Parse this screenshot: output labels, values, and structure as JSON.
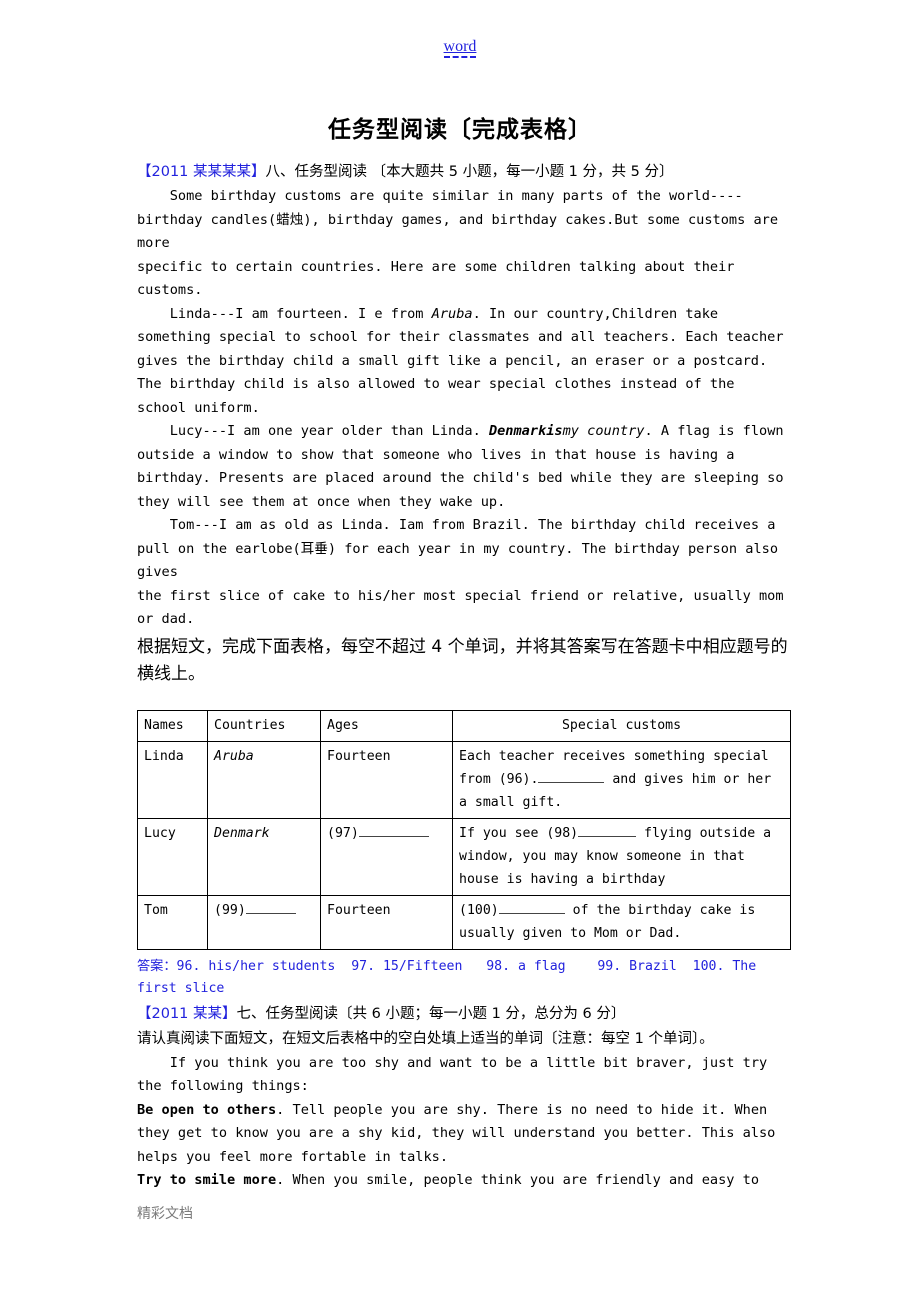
{
  "header": {
    "watermark_link": "word"
  },
  "title": "任务型阅读〔完成表格〕",
  "section1": {
    "heading_blue": "【2011 某某某某】",
    "heading_rest": "八、任务型阅读  〔本大题共 5 小题，每一小题 1 分，共 5 分〕",
    "p1_line1": "    Some birthday customs are quite similar in many parts of the world----",
    "p1_line2": "birthday candles(蜡烛), birthday games, and birthday cakes.But some customs are more",
    "p1_line3": "specific to certain countries. Here are some children talking about their",
    "p1_line4": "customs.",
    "p2_pre": "    Linda---I am fourteen. I e from ",
    "p2_italic": "Aruba",
    "p2_post": ". In our country,Children take\nsomething special to school for their classmates and all teachers. Each teacher\ngives the birthday child a small gift like a pencil, an eraser or a postcard.\nThe birthday child is also allowed to wear special clothes instead of the\nschool uniform.",
    "p3_pre": "    Lucy---I am one year older than Linda. ",
    "p3_bolditalic": "Denmarkis",
    "p3_italic": "my country",
    "p3_post": ". A flag is flown\noutside a window to show that someone who lives in that house is having a\nbirthday. Presents are placed around the child's bed while they are sleeping so\nthey will see them at once when they wake up.",
    "p4": "    Tom---I am as old as Linda. Iam from Brazil. The birthday child receives a\npull on the earlobe(耳垂) for each year in my country. The birthday person also gives\nthe first slice of cake to his/her most special friend or relative, usually mom\nor dad.",
    "cn_instruction": "根据短文，完成下面表格，每空不超过 4 个单词，并将其答案写在答题卡中相应题号的横线上。"
  },
  "table": {
    "headers": [
      "Names",
      "Countries",
      "Ages",
      "Special customs"
    ],
    "rows": [
      {
        "name": "Linda",
        "country": "Aruba",
        "country_style": "bold-italic",
        "age": "Fourteen",
        "custom_pre": "Each teacher receives something special from (96).",
        "custom_post": " and gives him or her a small gift."
      },
      {
        "name": "Lucy",
        "country": "Denmark",
        "country_style": "bold-italic",
        "age_pre": "(97)",
        "age_post": "",
        "custom_pre": "If you see (98)",
        "custom_post": " flying outside a window, you may know someone in that house is having a birthday"
      },
      {
        "name": "Tom",
        "country_pre": "(99)",
        "country_post": "",
        "age": "Fourteen",
        "custom_pre": "(100)",
        "custom_post": " of the birthday cake is usually given to Mom or Dad."
      }
    ]
  },
  "answers": {
    "text": "答案：96. his/her students  97. 15/Fifteen   98. a flag    99. Brazil  100. The first slice",
    "color": "#2222dd"
  },
  "section2": {
    "heading_blue": "【2011 某某】",
    "heading_rest": "七、任务型阅读〔共 6 小题；每一小题 1 分，总分为 6 分〕",
    "cn_instruction": "     请认真阅读下面短文，在短文后表格中的空白处填上适当的单词〔注意：每空 1 个单词〕。",
    "p1": "    If you think you are too shy and want to be a little bit braver, just try\nthe following things:",
    "p2_bold": "Be open to others",
    "p2_rest": ". Tell people you are shy. There is no need to hide it. When\nthey get to know you are a shy kid, they will understand you better. This also\nhelps you feel more fortable in talks.",
    "p3_bold": "Try to smile more",
    "p3_rest": ". When you smile, people think you are friendly and easy to"
  },
  "footer": {
    "text": "精彩文档"
  }
}
